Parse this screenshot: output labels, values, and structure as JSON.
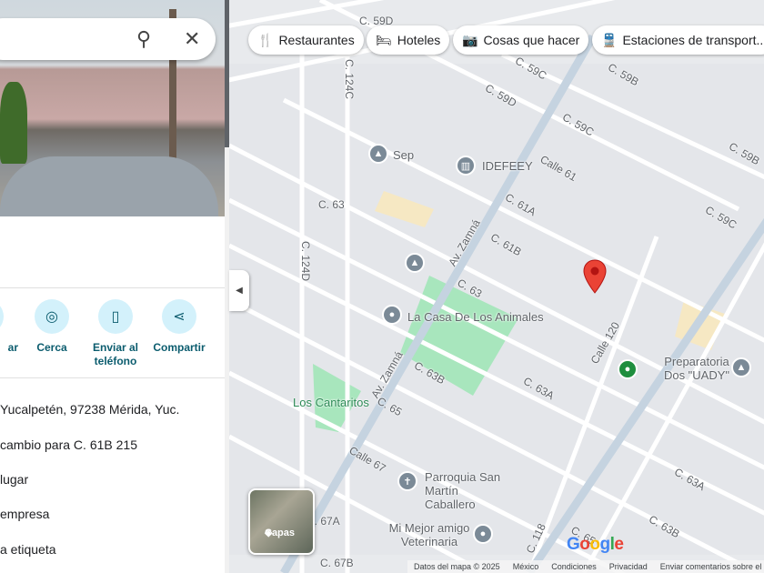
{
  "search": {
    "search_icon": "search-icon",
    "close_icon": "close-icon"
  },
  "actions": [
    {
      "label": "ar",
      "icon": "route"
    },
    {
      "label": "Cerca",
      "icon": "nearby"
    },
    {
      "label": "Enviar al teléfono",
      "icon": "phone"
    },
    {
      "label": "Compartir",
      "icon": "share"
    }
  ],
  "info": [
    "Yucalpetén, 97238 Mérida, Yuc.",
    "cambio para C. 61B 215",
    "lugar",
    "empresa",
    "a etiqueta"
  ],
  "chips": [
    {
      "label": "Restaurantes",
      "icon": "🍴"
    },
    {
      "label": "Hoteles",
      "icon": "🛏"
    },
    {
      "label": "Cosas que hacer",
      "icon": "📷"
    },
    {
      "label": "Estaciones de transport...",
      "icon": "🚆"
    }
  ],
  "streets": [
    "C. 59D",
    "C. 59C",
    "C. 59D",
    "C. 59B",
    "C. 59C",
    "Calle 61",
    "C. 59B",
    "C. 124C",
    "C. 63",
    "C. 61A",
    "C. 61B",
    "C. 59C",
    "C. 124D",
    "Av. Zamná",
    "C. 63",
    "Calle 120",
    "C. 63B",
    "C. 63A",
    "C. 65",
    "Av. Zamná",
    "Calle 67",
    "C. 67A",
    "C. 67B",
    "C. 118",
    "C. 65",
    "C. 63A",
    "C. 63B"
  ],
  "pois": {
    "sep": "Sep",
    "idefeey": "IDEFEEY",
    "casa_animales": "La Casa De Los Animales",
    "cantaritos": "Los Cantaritos",
    "parroquia": "Parroquia San Martín Caballero",
    "veterinaria": "Mi Mejor amigo Veterinaria",
    "preparatoria": "Preparatoria Dos \"UADY\""
  },
  "layers_label": "Capas",
  "google_logo": "Google",
  "footer": [
    "Datos del mapa © 2025",
    "México",
    "Condiciones",
    "Privacidad",
    "Enviar comentarios sobre el producto"
  ],
  "colors": {
    "accent": "#0b5c6e",
    "marker": "#ea4335",
    "park": "#a8e6bd"
  }
}
